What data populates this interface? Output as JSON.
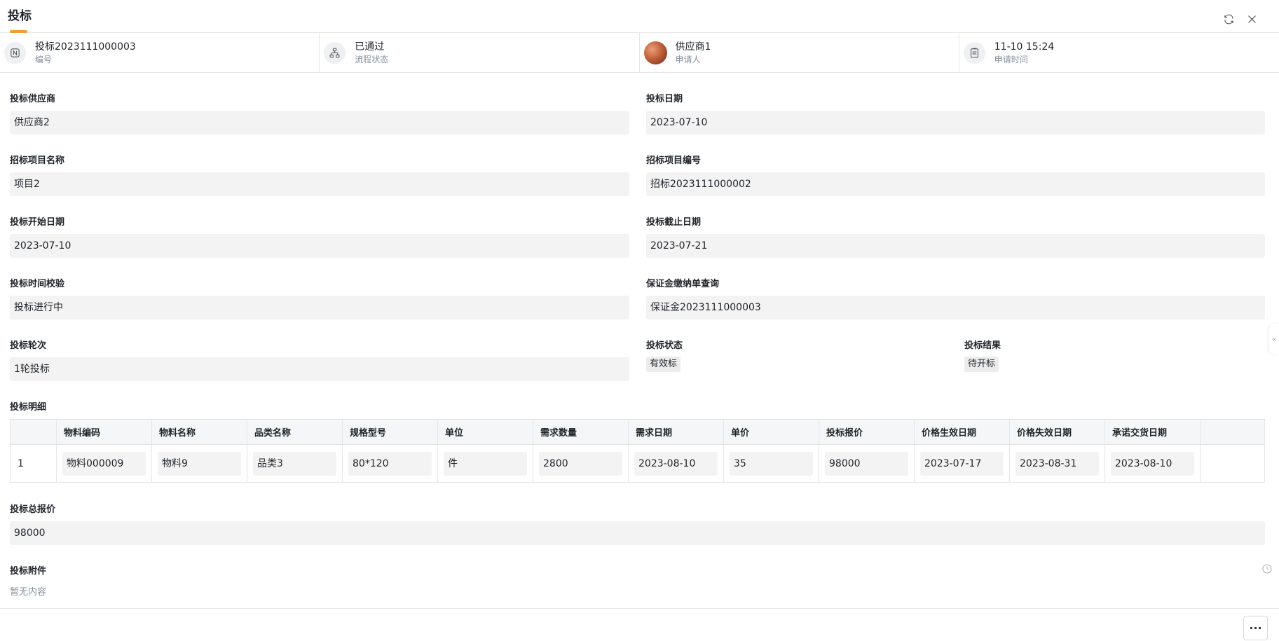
{
  "header": {
    "title": "投标",
    "refresh_icon": "refresh-icon",
    "close_icon": "close-icon"
  },
  "info": [
    {
      "value": "投标2023111000003",
      "label": "编号",
      "icon": "number-icon"
    },
    {
      "value": "已通过",
      "label": "流程状态",
      "icon": "workflow-icon"
    },
    {
      "value": "供应商1",
      "label": "申请人",
      "icon": "avatar"
    },
    {
      "value": "11-10 15:24",
      "label": "申请时间",
      "icon": "clipboard-icon"
    }
  ],
  "form": {
    "supplier": {
      "label": "投标供应商",
      "value": "供应商2"
    },
    "bid_date": {
      "label": "投标日期",
      "value": "2023-07-10"
    },
    "project_name": {
      "label": "招标项目名称",
      "value": "项目2"
    },
    "project_code": {
      "label": "招标项目编号",
      "value": "招标2023111000002"
    },
    "start_date": {
      "label": "投标开始日期",
      "value": "2023-07-10"
    },
    "end_date": {
      "label": "投标截止日期",
      "value": "2023-07-21"
    },
    "time_check": {
      "label": "投标时间校验",
      "value": "投标进行中"
    },
    "deposit": {
      "label": "保证金缴纳单查询",
      "value": "保证金2023111000003"
    },
    "round": {
      "label": "投标轮次",
      "value": "1轮投标"
    },
    "status": {
      "label": "投标状态",
      "value": "有效标"
    },
    "result": {
      "label": "投标结果",
      "value": "待开标"
    },
    "detail_label": "投标明细",
    "total": {
      "label": "投标总报价",
      "value": "98000"
    },
    "attachment": {
      "label": "投标附件",
      "value": "暂无内容"
    }
  },
  "table": {
    "columns": [
      "物料编码",
      "物料名称",
      "品类名称",
      "规格型号",
      "单位",
      "需求数量",
      "需求日期",
      "单价",
      "投标报价",
      "价格生效日期",
      "价格失效日期",
      "承诺交货日期"
    ],
    "rows": [
      {
        "index": "1",
        "cells": [
          "物料000009",
          "物料9",
          "品类3",
          "80*120",
          "件",
          "2800",
          "2023-08-10",
          "35",
          "98000",
          "2023-07-17",
          "2023-08-31",
          "2023-08-10"
        ]
      }
    ]
  },
  "footer": {
    "more_label": "···"
  }
}
